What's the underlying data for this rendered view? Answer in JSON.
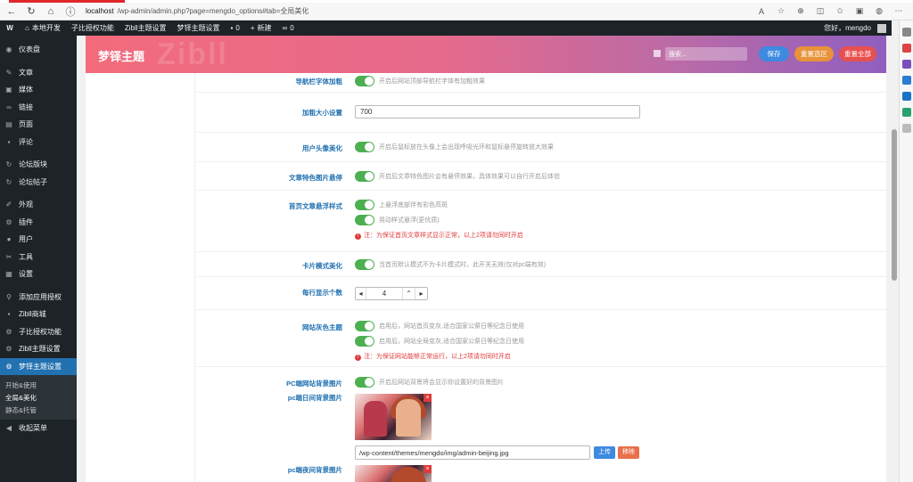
{
  "browser": {
    "url_host": "localhost",
    "url_path": "/wp-admin/admin.php?page=mengdo_options#tab=全局美化",
    "zoom_label": "A"
  },
  "adminbar": {
    "site": "本地开发",
    "items": [
      "子比授权功能",
      "Zibll主题设置",
      "梦铎主题设置"
    ],
    "comments": "0",
    "new": "新建",
    "links_count": "0",
    "greeting": "您好，mengdo"
  },
  "sidebar": {
    "items": [
      {
        "icon": "dashboard-icon",
        "glyph": "◉",
        "label": "仪表盘"
      },
      {
        "icon": "pin-icon",
        "glyph": "✎",
        "label": "文章"
      },
      {
        "icon": "media-icon",
        "glyph": "▣",
        "label": "媒体"
      },
      {
        "icon": "link-icon",
        "glyph": "∞",
        "label": "链接"
      },
      {
        "icon": "page-icon",
        "glyph": "▤",
        "label": "页面"
      },
      {
        "icon": "comment-icon",
        "glyph": "▪",
        "label": "评论"
      },
      {
        "icon": "forum-icon",
        "glyph": "↻",
        "label": "论坛版块"
      },
      {
        "icon": "forum-posts-icon",
        "glyph": "↻",
        "label": "论坛帖子"
      },
      {
        "icon": "appearance-icon",
        "glyph": "✐",
        "label": "外观"
      },
      {
        "icon": "plugins-icon",
        "glyph": "⚙",
        "label": "插件"
      },
      {
        "icon": "users-icon",
        "glyph": "●",
        "label": "用户"
      },
      {
        "icon": "tools-icon",
        "glyph": "✂",
        "label": "工具"
      },
      {
        "icon": "settings-icon",
        "glyph": "▦",
        "label": "设置"
      },
      {
        "icon": "search-icon",
        "glyph": "⚲",
        "label": "添加应用授权"
      },
      {
        "icon": "shop-icon",
        "glyph": "▪",
        "label": "Zibll商城"
      },
      {
        "icon": "gear-icon",
        "glyph": "⚙",
        "label": "子比授权功能"
      },
      {
        "icon": "gear-icon",
        "glyph": "⚙",
        "label": "Zibll主题设置"
      },
      {
        "icon": "gear-icon",
        "glyph": "⚙",
        "label": "梦铎主题设置"
      }
    ],
    "submenu": [
      "开始&使用",
      "全局&美化",
      "静态&托管"
    ],
    "collapse": "收起菜单"
  },
  "header": {
    "title": "梦铎主题",
    "watermark": "Zibll",
    "search_placeholder": "搜索...",
    "save": "保存",
    "reset_section": "重置选区",
    "reset_all": "重置全部"
  },
  "settings": {
    "nav_bold": {
      "label": "导航栏字体加粗",
      "desc": "开启后网站顶部导航栏字体有加粗效果"
    },
    "bold_size": {
      "label": "加粗大小设置",
      "value": "700"
    },
    "avatar": {
      "label": "用户头像美化",
      "desc": "开启后鼠标放在头像上会出现呼吸光环和鼠标悬停旋转放大效果"
    },
    "featured": {
      "label": "文章特色图片悬停",
      "desc": "开启后文章特色图片会有悬停效果，具体效果可以自行开启后体验"
    },
    "homelist": {
      "label": "首页文章悬浮样式",
      "opt1": "上悬浮底部伴有彩色高斑",
      "opt2": "晃动样式悬浮(更优质)",
      "warn": "注：为保证首页文章样式显示正常，以上2项请勿同时开启"
    },
    "card": {
      "label": "卡片模式美化",
      "desc": "当首页默认模式不为卡片模式时，此开关无效(仅对pc端有效)"
    },
    "per_row": {
      "label": "每行显示个数",
      "value": "4"
    },
    "gray": {
      "label": "网站灰色主题",
      "opt1": "启用后，网站首页变灰,适合国家公祭日等纪念日使用",
      "opt2": "启用后，网站全局变灰,适合国家公祭日等纪念日使用",
      "warn": "注：为保证网站能够正常运行，以上2项请勿同时开启"
    },
    "pc_bg": {
      "label": "PC端网站背景图片",
      "desc": "开启后网站背景将会显示你设置好的背景图片"
    },
    "pc_day": {
      "label": "pc端日间背景图片",
      "path": "/wp-content/themes/mengdo/img/admin-beijing.jpg",
      "upload": "上传",
      "remove": "移除"
    },
    "pc_night": {
      "label": "pc端夜间背景图片"
    }
  }
}
